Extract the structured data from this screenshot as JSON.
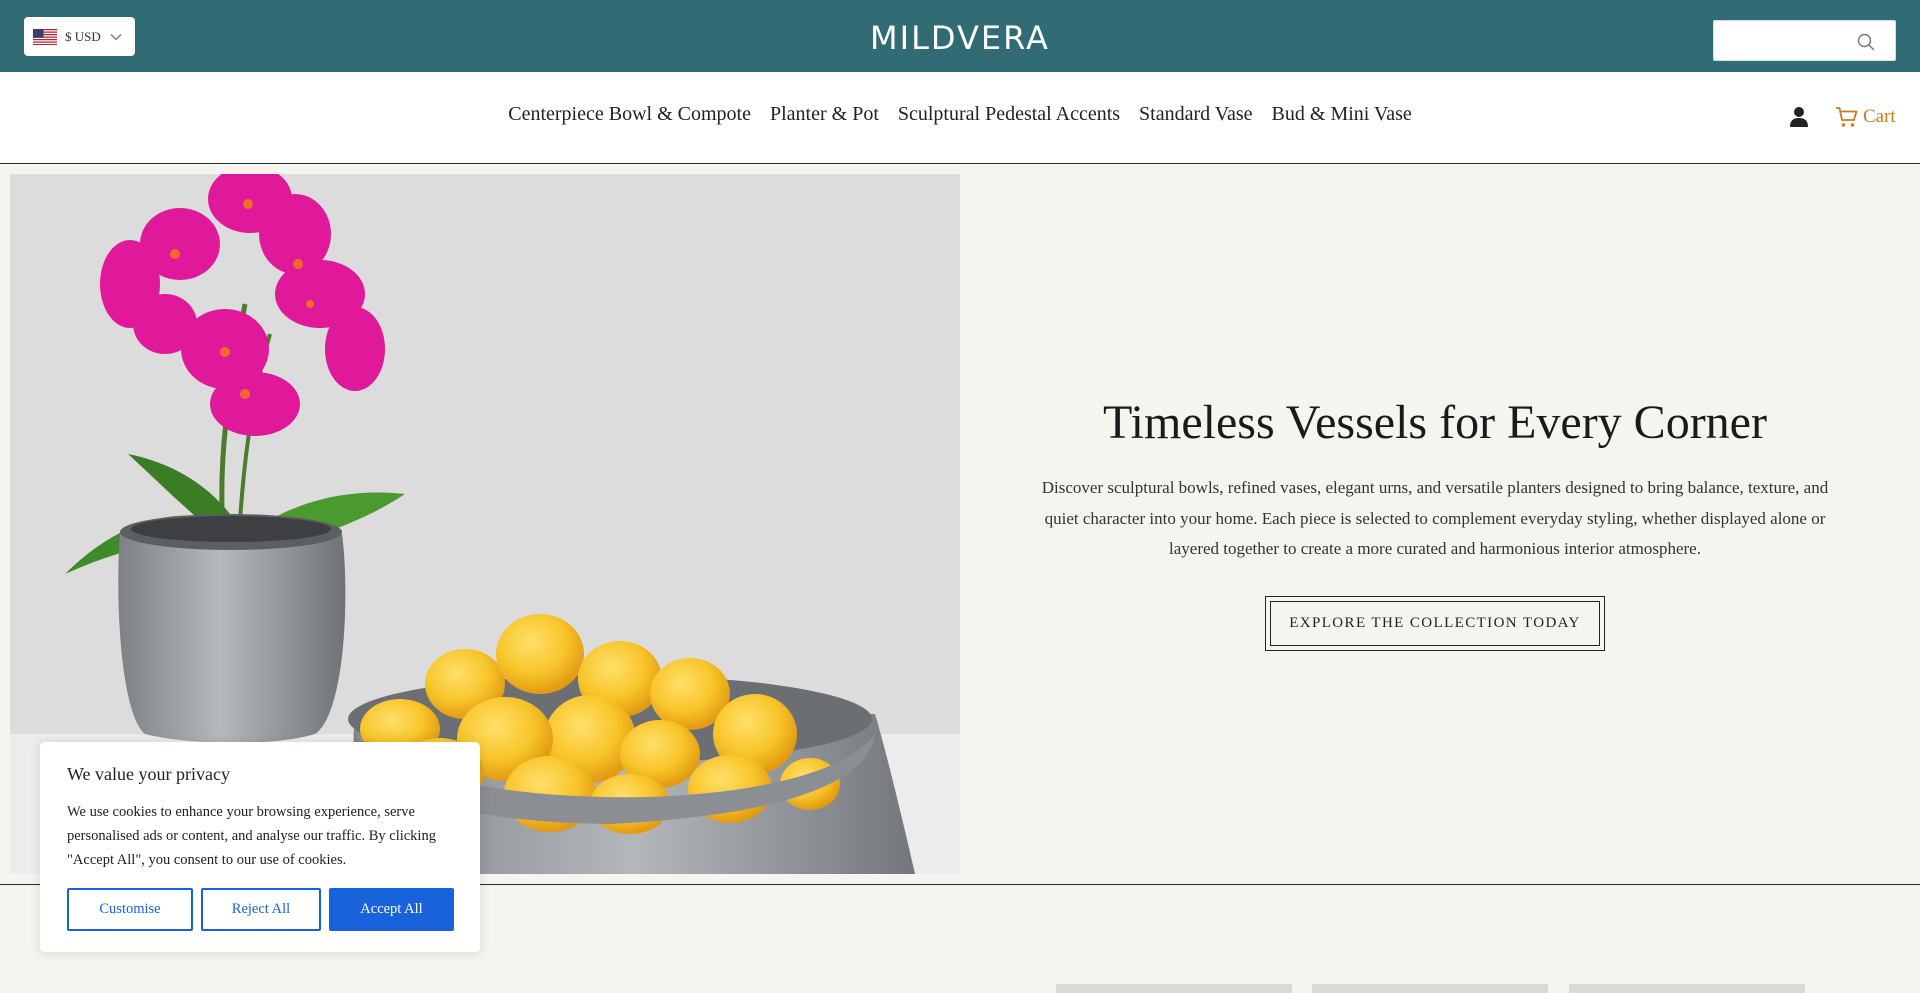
{
  "topbar": {
    "currency_label": "$ USD",
    "brand": "MILDVERA",
    "search_placeholder": "",
    "background_color": "#316b73"
  },
  "nav": {
    "items": [
      {
        "label": "Centerpiece Bowl & Compote"
      },
      {
        "label": "Planter & Pot"
      },
      {
        "label": "Sculptural Pedestal Accents"
      },
      {
        "label": "Standard Vase"
      },
      {
        "label": "Bud & Mini Vase"
      }
    ],
    "account_icon": "person-icon",
    "cart_label": "Cart",
    "cart_color": "#c77b21"
  },
  "hero": {
    "title": "Timeless Vessels for Every Corner",
    "text": "Discover sculptural bowls, refined vases, elegant urns, and versatile planters designed to bring balance, texture, and quiet character into your home. Each piece is selected to complement everyday styling, whether displayed alone or layered together to create a more curated and harmonious interior atmosphere.",
    "button_label": "Explore the collection today"
  },
  "cookie": {
    "title": "We value your privacy",
    "text": "We use cookies to enhance your browsing experience, serve personalised ads or content, and analyse our traffic. By clicking \"Accept All\", you consent to our use of cookies.",
    "customise_label": "Customise",
    "reject_label": "Reject All",
    "accept_label": "Accept All",
    "accent_color": "#1863dc"
  }
}
